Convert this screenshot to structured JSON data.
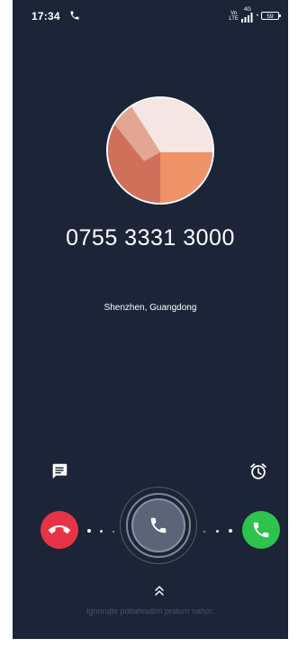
{
  "status_bar": {
    "time": "17:34",
    "network_top": "4G",
    "volte_top": "Vo",
    "volte_bottom": "LTE",
    "battery": "59"
  },
  "caller": {
    "number": "0755 3331 3000",
    "location": "Shenzhen, Guangdong"
  },
  "actions": {
    "message_icon": "message-icon",
    "reminder_icon": "alarm-clock-icon",
    "reject_icon": "hang-up-icon",
    "answer_icon": "phone-icon"
  },
  "hint": {
    "text": "Ignorujte potiahnutím prstom nahor."
  },
  "colors": {
    "background": "#1c2438",
    "reject": "#e63446",
    "answer": "#2ec34d",
    "handle": "#5b6478"
  }
}
